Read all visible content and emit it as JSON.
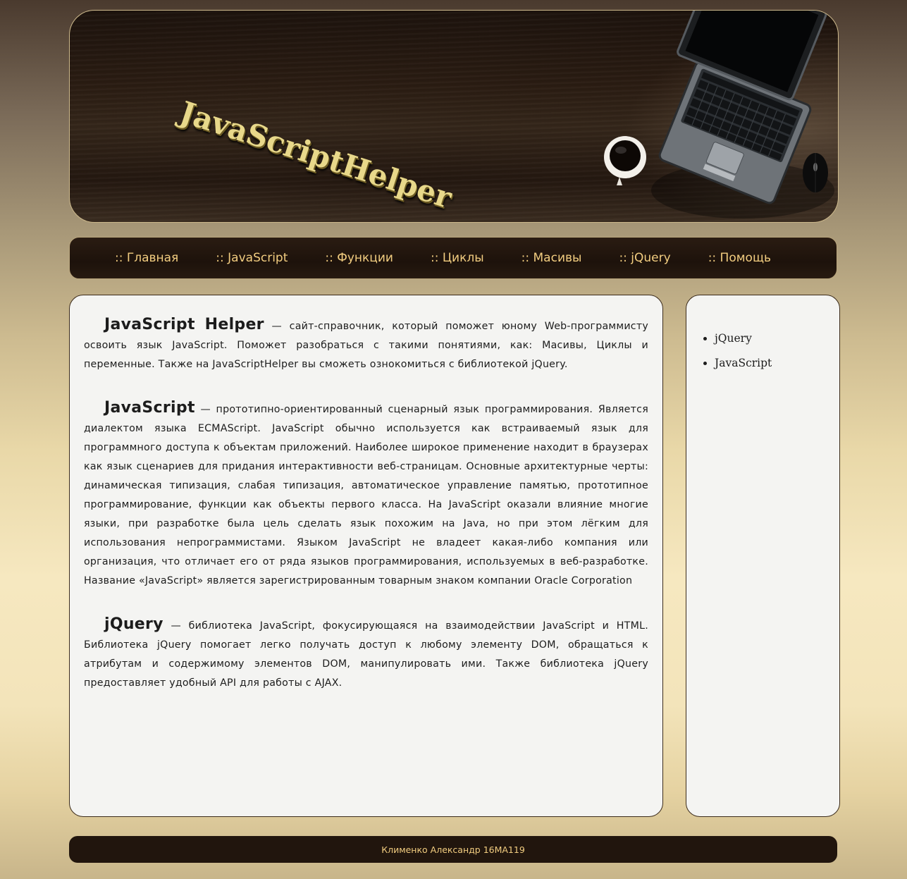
{
  "header": {
    "logo_text": "JavaScriptHelper"
  },
  "nav": {
    "items": [
      ":: Главная",
      ":: JavaScript",
      ":: Функции",
      ":: Циклы",
      ":: Масивы",
      ":: jQuery",
      ":: Помощь"
    ]
  },
  "main": {
    "sections": [
      {
        "term": "JavaScript Helper",
        "text": " — сайт-справочник, который поможет юному Web-программисту освоить язык JavaScript. Поможет разобраться с такими понятиями, как: Масивы, Циклы и переменные. Также на JavaScriptHelper вы сможеть ознокомиться с библиотекой jQuery."
      },
      {
        "term": "JavaScript",
        "text": " — прототипно-ориентированный сценарный язык программирования. Является диалектом языка ECMAScript. JavaScript обычно используется как встраиваемый язык для программного доступа к объектам приложений. Наиболее широкое применение находит в браузерах как язык сценариев для придания интерактивности веб-страницам. Основные архитектурные черты: динамическая типизация, слабая типизация, автоматическое управление памятью, прототипное программирование, функции как объекты первого класса. На JavaScript оказали влияние многие языки, при разработке была цель сделать язык похожим на Java, но при этом лёгким для использования непрограммистами. Языком JavaScript не владеет какая-либо компания или организация, что отличает его от ряда языков программирования, используемых в веб-разработке. Название «JavaScript» является зарегистрированным товарным знаком компании Oracle Corporation"
      },
      {
        "term": "jQuery",
        "text": " — библиотека JavaScript, фокусирующаяся на взаимодействии JavaScript и HTML. Библиотека jQuery помогает легко получать доступ к любому элементу DOM, обращаться к атрибутам и содержимому элементов DOM, манипулировать ими. Также библиотека jQuery предоставляет удобный API для работы с AJAX."
      }
    ]
  },
  "sidebar": {
    "links": [
      "jQuery",
      "JavaScript"
    ]
  },
  "footer": {
    "text": "Клименко Александр 16МА119"
  }
}
